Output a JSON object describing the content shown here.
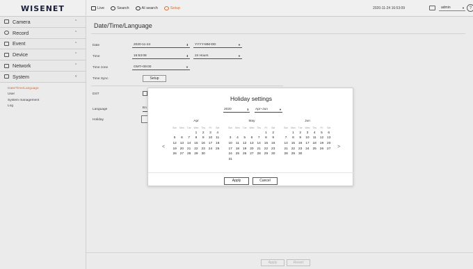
{
  "logo": "WISENET",
  "topnav": [
    {
      "label": "Live",
      "icon": "monitor-icon",
      "active": false
    },
    {
      "label": "Search",
      "icon": "search-icon",
      "active": false
    },
    {
      "label": "AI search",
      "icon": "ai-search-icon",
      "active": false
    },
    {
      "label": "Setup",
      "icon": "gear-icon",
      "active": true
    }
  ],
  "header": {
    "datetime": "2020-11-24 16:53:09",
    "user": "admin",
    "help": "?"
  },
  "sidebar": {
    "menus": [
      {
        "label": "Camera",
        "icon": "camera-icon",
        "chevron": "^"
      },
      {
        "label": "Record",
        "icon": "record-icon",
        "chevron": "^"
      },
      {
        "label": "Event",
        "icon": "bell-icon",
        "chevron": "^"
      },
      {
        "label": "Device",
        "icon": "device-icon",
        "chevron": "^"
      },
      {
        "label": "Network",
        "icon": "network-icon",
        "chevron": "^"
      },
      {
        "label": "System",
        "icon": "system-icon",
        "chevron": "v"
      }
    ],
    "subitems": [
      "Date/Time/Language",
      "User",
      "System management",
      "Log"
    ]
  },
  "main": {
    "title": "Date/Time/Language",
    "labels": {
      "date": "Date",
      "time": "Time",
      "timezone": "Time zone",
      "timesync": "Time Sync",
      "dst": "DST",
      "language": "Language",
      "holiday": "Holiday"
    },
    "date_value": "2020-11-24",
    "date_format": "YYYY-MM-DD",
    "time_value": "16:53:08",
    "time_format": "24 Hours",
    "timezone_value": "GMT+09:00",
    "setup_label": "Setup",
    "language_value": "En",
    "apply_label": "Apply",
    "revert_label": "Revert"
  },
  "modal": {
    "title": "Holiday settings",
    "year": "2020",
    "range": "Apr~Jun",
    "weekdays": [
      "Sun",
      "Mon",
      "Tue",
      "Wed",
      "Thu",
      "Fri",
      "Sat"
    ],
    "months": [
      {
        "name": "Apr",
        "weeks": [
          [
            "",
            "",
            "",
            "1",
            "2",
            "3",
            "4"
          ],
          [
            "5",
            "6",
            "7",
            "8",
            "9",
            "10",
            "11"
          ],
          [
            "12",
            "13",
            "14",
            "15",
            "16",
            "17",
            "18"
          ],
          [
            "19",
            "20",
            "21",
            "22",
            "23",
            "24",
            "25"
          ],
          [
            "26",
            "27",
            "28",
            "29",
            "30",
            "",
            ""
          ],
          [
            "",
            "",
            "",
            "",
            "",
            "",
            ""
          ]
        ]
      },
      {
        "name": "May",
        "weeks": [
          [
            "",
            "",
            "",
            "",
            "",
            "1",
            "2"
          ],
          [
            "3",
            "4",
            "5",
            "6",
            "7",
            "8",
            "9"
          ],
          [
            "10",
            "11",
            "12",
            "13",
            "14",
            "15",
            "16"
          ],
          [
            "17",
            "18",
            "19",
            "20",
            "21",
            "22",
            "23"
          ],
          [
            "24",
            "25",
            "26",
            "27",
            "28",
            "29",
            "30"
          ],
          [
            "31",
            "",
            "",
            "",
            "",
            "",
            ""
          ]
        ]
      },
      {
        "name": "Jun",
        "weeks": [
          [
            "",
            "1",
            "2",
            "3",
            "4",
            "5",
            "6"
          ],
          [
            "7",
            "8",
            "9",
            "10",
            "11",
            "12",
            "13"
          ],
          [
            "14",
            "15",
            "16",
            "17",
            "18",
            "19",
            "20"
          ],
          [
            "21",
            "22",
            "23",
            "24",
            "25",
            "26",
            "27"
          ],
          [
            "28",
            "29",
            "30",
            "",
            "",
            "",
            ""
          ],
          [
            "",
            "",
            "",
            "",
            "",
            "",
            ""
          ]
        ]
      }
    ],
    "prev": "<",
    "next": ">",
    "apply_label": "Apply",
    "cancel_label": "Cancel"
  },
  "colors": {
    "accent": "#e0773a",
    "logo": "#1a1f3c"
  }
}
